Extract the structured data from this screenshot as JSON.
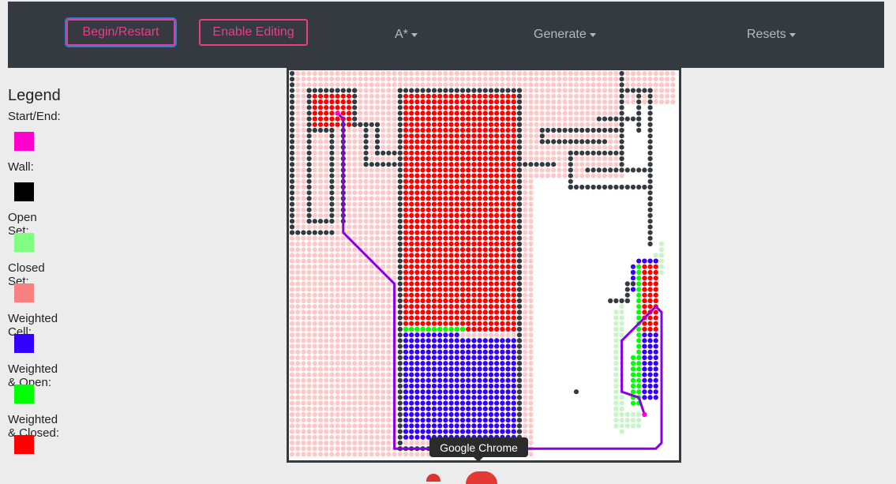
{
  "toolbar": {
    "begin_label": "Begin/Restart",
    "edit_label": "Enable Editing",
    "algorithm_label": "A*",
    "generate_label": "Generate",
    "resets_label": "Resets"
  },
  "legend": {
    "title": "Legend",
    "items": [
      {
        "label": "Start/End:",
        "color": "#ff00cc"
      },
      {
        "label": "Wall:",
        "color": "#000000"
      },
      {
        "label": "Open Set:",
        "color": "#80ff80"
      },
      {
        "label": "Closed Set:",
        "color": "#f88080"
      },
      {
        "label": "Weighted Cell:",
        "color": "#3300ff"
      },
      {
        "label": "Weighted & Open:",
        "color": "#00ff00"
      },
      {
        "label": "Weighted & Closed:",
        "color": "#ff0000"
      }
    ]
  },
  "tooltip": {
    "text": "Google Chrome"
  },
  "colors": {
    "navbar": "#343a40",
    "accent": "#e83e8c",
    "wall": "#343a40",
    "closed": "#ffc8c8",
    "open": "#c8f5c8",
    "weighted": "#3300ff",
    "weighted_open": "#00ff00",
    "weighted_closed": "#ff0000",
    "path": "#8a00e0"
  }
}
